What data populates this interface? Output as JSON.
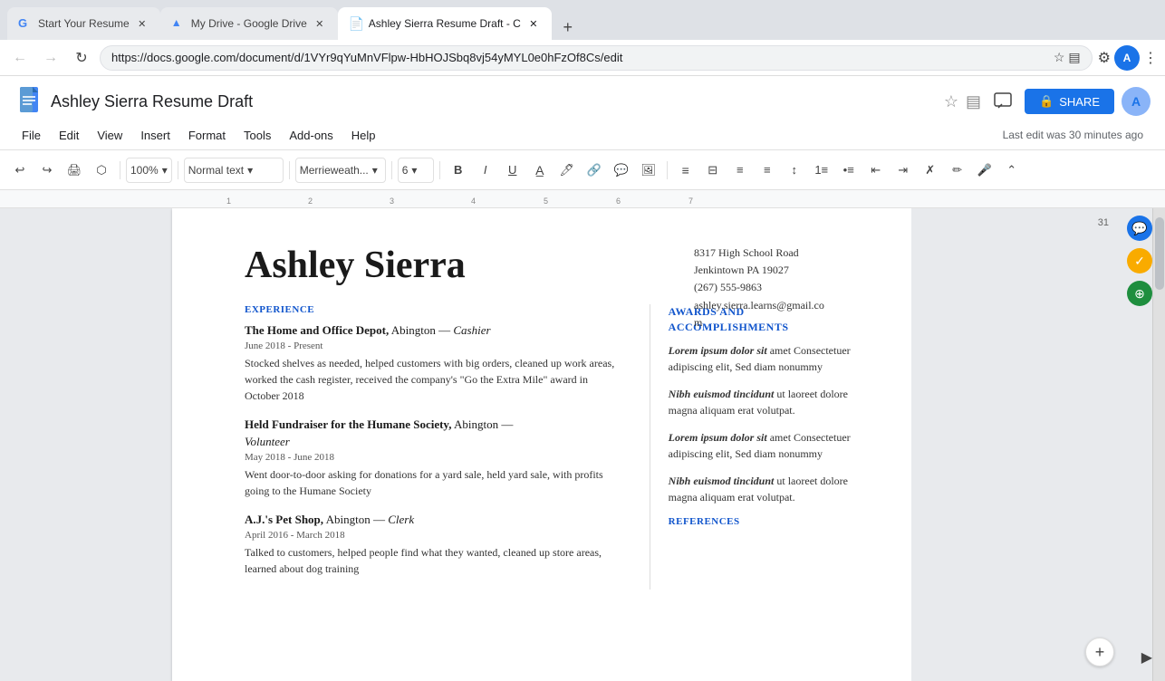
{
  "browser": {
    "tabs": [
      {
        "id": "tab1",
        "title": "Start Your Resume",
        "favicon": "G",
        "active": false
      },
      {
        "id": "tab2",
        "title": "My Drive - Google Drive",
        "favicon": "D",
        "active": false
      },
      {
        "id": "tab3",
        "title": "Ashley Sierra Resume Draft - C",
        "favicon": "D",
        "active": true
      }
    ],
    "url": "https://docs.google.com/document/d/1VYr9qYuMnVFlpw-HbHOJSbq8vj54yMYL0e0hFzOf8Cs/edit",
    "new_tab_label": "+"
  },
  "docs": {
    "title": "Ashley Sierra Resume Draft",
    "last_edit": "Last edit was 30 minutes ago",
    "share_label": "SHARE",
    "menu_items": [
      "File",
      "Edit",
      "View",
      "Insert",
      "Format",
      "Tools",
      "Add-ons",
      "Help"
    ],
    "toolbar": {
      "zoom": "100%",
      "style": "Normal text",
      "font": "Merrieweath...",
      "size": "6",
      "undo_label": "↩",
      "redo_label": "↪"
    }
  },
  "resume": {
    "name": "Ashley Sierra",
    "contact": {
      "address": "8317 High School Road",
      "city_state": "Jenkintown PA 19027",
      "phone": "(267) 555-9863",
      "email": "ashley.sierra.learns@gmail.com"
    },
    "experience_label": "EXPERIENCE",
    "jobs": [
      {
        "title_html": "The Home and Office Depot, Abington — Cashier",
        "title_plain": "The Home and Office Depot,",
        "title_location": " Abington — ",
        "title_role": "Cashier",
        "dates": "June 2018 - Present",
        "description": "Stocked shelves as needed, helped customers with big orders, cleaned up work areas, worked the cash register, received the company's \"Go the Extra Mile\" award in October 2018"
      },
      {
        "title_plain": "Held Fundraiser for the Humane Society,",
        "title_location": " Abington — ",
        "title_role": "Volunteer",
        "dates": "May 2018 - June 2018",
        "description": "Went door-to-door asking for donations for a yard sale, held yard sale, with profits going to the Humane Society"
      },
      {
        "title_plain": "A.J.'s Pet Shop,",
        "title_location": " Abington — ",
        "title_role": "Clerk",
        "dates": "April 2016 - March 2018",
        "description": "Talked to customers, helped people find what they wanted, cleaned up store areas, learned about dog training"
      }
    ],
    "awards_label": "AWARDS AND ACCOMPLISHMENTS",
    "awards": [
      {
        "heading": "Lorem ipsum dolor",
        "heading_em": " sit",
        "text": " amet Consectetuer adipiscing elit, Sed diam nonummy"
      },
      {
        "heading": "Nibh euismod tincidunt",
        "heading_plain": " ut laoreet dolore magna aliquam erat volutpat.",
        "text": ""
      },
      {
        "heading": "Lorem ipsum dolor",
        "heading_em": " sit",
        "text": " amet Consectetuer adipiscing elit, Sed diam nonummy"
      },
      {
        "heading": "Nibh euismod tincidunt",
        "heading_plain": " ut laoreet dolore magna aliquam erat volutpat.",
        "text": ""
      }
    ],
    "references_label": "REFERENCES"
  },
  "page_number": "31",
  "sidebar_icons": [
    {
      "id": "comment-icon",
      "symbol": "💬",
      "color": "blue"
    },
    {
      "id": "spelling-icon",
      "symbol": "✓",
      "color": "yellow"
    },
    {
      "id": "explore-icon",
      "symbol": "⊕",
      "color": "teal"
    }
  ]
}
